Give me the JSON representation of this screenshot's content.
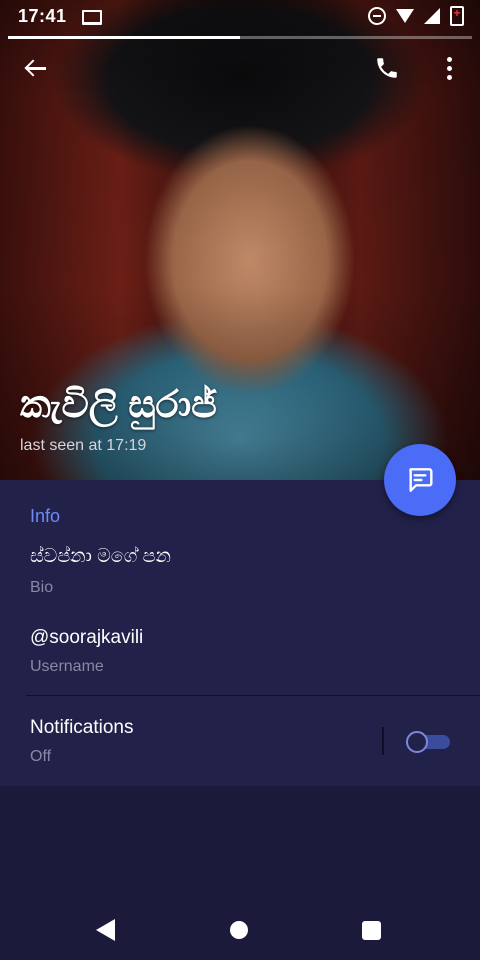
{
  "status_bar": {
    "time": "17:41"
  },
  "profile": {
    "name": "කැවිලි සුරාජ්",
    "last_seen": "last seen at 17:19",
    "progress": 0.5
  },
  "info": {
    "section_title": "Info",
    "bio_value": "ස්වප්නා මගේ පන",
    "bio_label": "Bio",
    "username_value": "@soorajkavili",
    "username_label": "Username",
    "notifications_label": "Notifications",
    "notifications_state": "Off",
    "notifications_enabled": false
  },
  "colors": {
    "accent": "#4a6cf7",
    "section_title": "#6c8cf8",
    "background": "#1b1a3a",
    "card": "#22214a"
  },
  "icons": {
    "back": "arrow-left-icon",
    "call": "phone-icon",
    "more": "more-vertical-icon",
    "fab": "message-icon",
    "nav_back": "triangle-back-icon",
    "nav_home": "circle-home-icon",
    "nav_recent": "square-recent-icon"
  }
}
